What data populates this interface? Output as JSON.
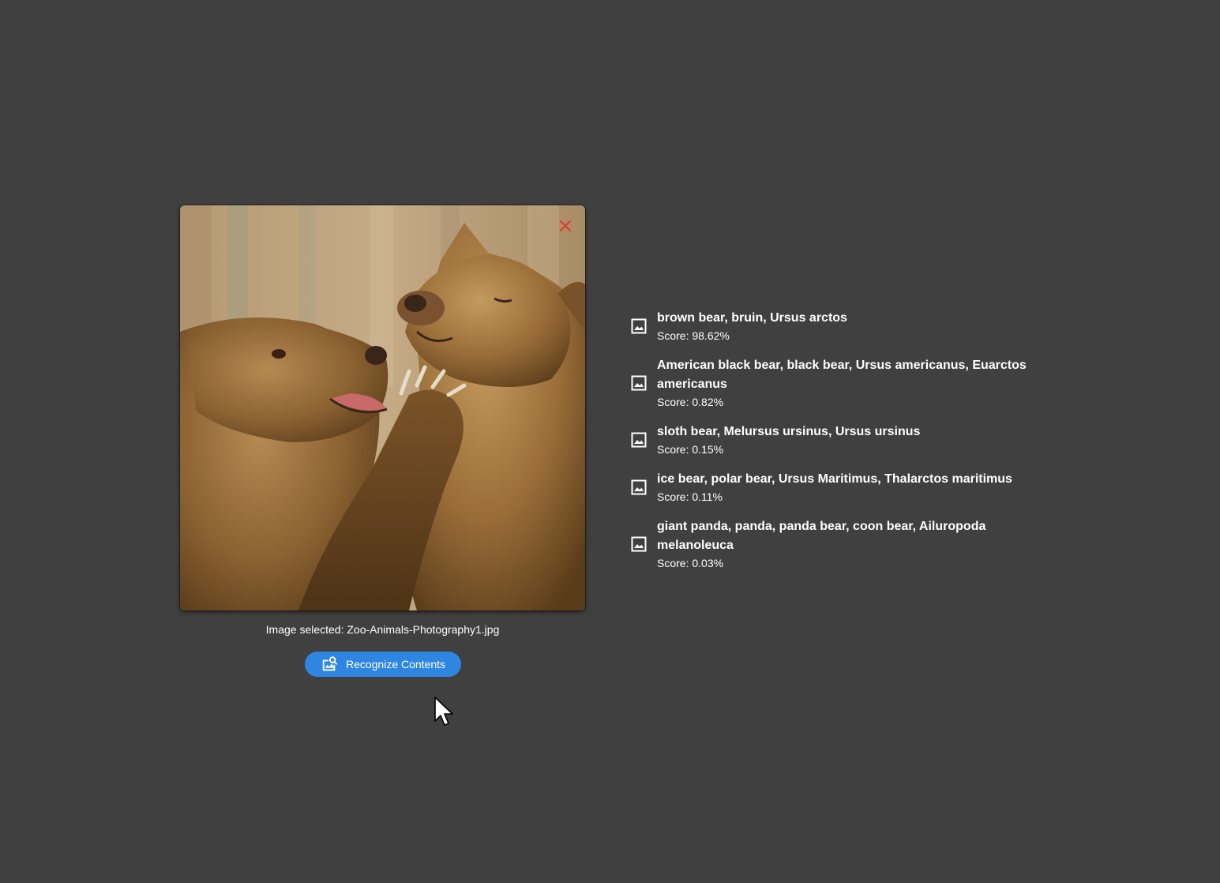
{
  "image": {
    "close_icon": "close-icon",
    "alt": "Two brown bears"
  },
  "file_caption": "Image selected: Zoo-Animals-Photography1.jpg",
  "recognize_button": {
    "label": "Recognize Contents",
    "icon": "image-search-icon",
    "color": "#2f86e0"
  },
  "results": [
    {
      "label": "brown bear, bruin, Ursus arctos",
      "score": "Score: 98.62%",
      "icon": "image-icon"
    },
    {
      "label": "American black bear, black bear, Ursus americanus, Euarctos americanus",
      "score": "Score: 0.82%",
      "icon": "image-icon"
    },
    {
      "label": "sloth bear, Melursus ursinus, Ursus ursinus",
      "score": "Score: 0.15%",
      "icon": "image-icon"
    },
    {
      "label": "ice bear, polar bear, Ursus Maritimus, Thalarctos maritimus",
      "score": "Score: 0.11%",
      "icon": "image-icon"
    },
    {
      "label": "giant panda, panda, panda bear, coon bear, Ailuropoda melanoleuca",
      "score": "Score: 0.03%",
      "icon": "image-icon"
    }
  ],
  "colors": {
    "background": "#404040",
    "close_icon": "#e53935",
    "text": "#ffffff"
  }
}
